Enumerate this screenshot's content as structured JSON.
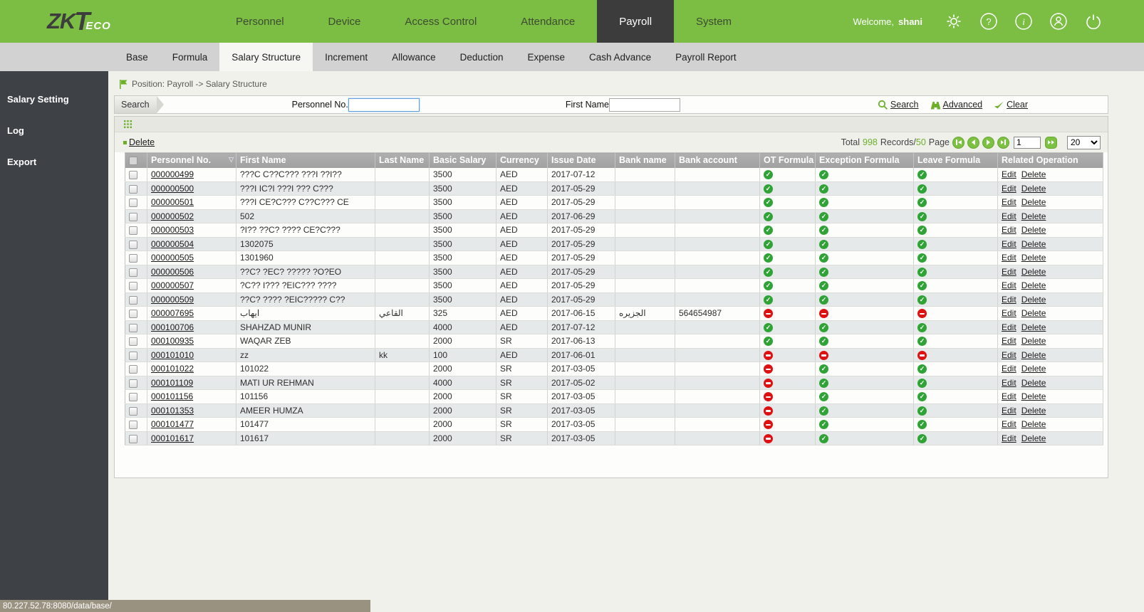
{
  "topnav": {
    "logo": {
      "zk": "ZK",
      "t": "T",
      "eco": "ECO"
    },
    "items": [
      {
        "label": "Personnel",
        "active": false
      },
      {
        "label": "Device",
        "active": false
      },
      {
        "label": "Access Control",
        "active": false
      },
      {
        "label": "Attendance",
        "active": false
      },
      {
        "label": "Payroll",
        "active": true
      },
      {
        "label": "System",
        "active": false
      }
    ],
    "welcome_label": "Welcome,",
    "username": "shani",
    "icons": [
      "settings-icon",
      "help-icon",
      "info-icon",
      "account-icon",
      "power-icon"
    ]
  },
  "tabs": [
    {
      "label": "Base",
      "active": false
    },
    {
      "label": "Formula",
      "active": false
    },
    {
      "label": "Salary Structure",
      "active": true
    },
    {
      "label": "Increment",
      "active": false
    },
    {
      "label": "Allowance",
      "active": false
    },
    {
      "label": "Deduction",
      "active": false
    },
    {
      "label": "Expense",
      "active": false
    },
    {
      "label": "Cash Advance",
      "active": false
    },
    {
      "label": "Payroll Report",
      "active": false
    }
  ],
  "sidebar": {
    "items": [
      "Salary Setting",
      "Log",
      "Export"
    ]
  },
  "breadcrumb": {
    "text": "Position: Payroll -> Salary Structure"
  },
  "search": {
    "panel_label": "Search",
    "fields": [
      {
        "label": "Personnel No.",
        "value": "",
        "focused": true
      },
      {
        "label": "First Name",
        "value": "",
        "focused": false
      }
    ],
    "actions": [
      {
        "label": "Search",
        "icon": "search-icon"
      },
      {
        "label": "Advanced",
        "icon": "advanced-icon"
      },
      {
        "label": "Clear",
        "icon": "clear-icon"
      }
    ]
  },
  "toolbar": {
    "delete_label": "Delete"
  },
  "pagination": {
    "total_label": "Total",
    "total": "998",
    "records_label": "Records/",
    "pages": "50",
    "page_label": "Page",
    "current_page": "1",
    "page_size": "20"
  },
  "table": {
    "columns": [
      "Personnel No.",
      "First Name",
      "Last Name",
      "Basic Salary",
      "Currency",
      "Issue Date",
      "Bank name",
      "Bank account",
      "OT Formula",
      "Exception Formula",
      "Leave Formula",
      "Related Operation"
    ],
    "actions": {
      "edit": "Edit",
      "delete": "Delete"
    },
    "rows": [
      {
        "personnel_no": "000000499",
        "first_name": "???C C??C??? ???I ??I??",
        "last_name": "",
        "basic_salary": "3500",
        "currency": "AED",
        "issue_date": "2017-07-12",
        "bank_name": "",
        "bank_account": "",
        "ot": "ok",
        "exception": "ok",
        "leave": "ok"
      },
      {
        "personnel_no": "000000500",
        "first_name": "???I IC?I ???I ??? C???",
        "last_name": "",
        "basic_salary": "3500",
        "currency": "AED",
        "issue_date": "2017-05-29",
        "bank_name": "",
        "bank_account": "",
        "ot": "ok",
        "exception": "ok",
        "leave": "ok"
      },
      {
        "personnel_no": "000000501",
        "first_name": "???I CE?C??? C??C??? CE",
        "last_name": "",
        "basic_salary": "3500",
        "currency": "AED",
        "issue_date": "2017-05-29",
        "bank_name": "",
        "bank_account": "",
        "ot": "ok",
        "exception": "ok",
        "leave": "ok"
      },
      {
        "personnel_no": "000000502",
        "first_name": "502",
        "last_name": "",
        "basic_salary": "3500",
        "currency": "AED",
        "issue_date": "2017-06-29",
        "bank_name": "",
        "bank_account": "",
        "ot": "ok",
        "exception": "ok",
        "leave": "ok"
      },
      {
        "personnel_no": "000000503",
        "first_name": "?I?? ??C? ???? CE?C???",
        "last_name": "",
        "basic_salary": "3500",
        "currency": "AED",
        "issue_date": "2017-05-29",
        "bank_name": "",
        "bank_account": "",
        "ot": "ok",
        "exception": "ok",
        "leave": "ok"
      },
      {
        "personnel_no": "000000504",
        "first_name": "1302075",
        "last_name": "",
        "basic_salary": "3500",
        "currency": "AED",
        "issue_date": "2017-05-29",
        "bank_name": "",
        "bank_account": "",
        "ot": "ok",
        "exception": "ok",
        "leave": "ok"
      },
      {
        "personnel_no": "000000505",
        "first_name": "1301960",
        "last_name": "",
        "basic_salary": "3500",
        "currency": "AED",
        "issue_date": "2017-05-29",
        "bank_name": "",
        "bank_account": "",
        "ot": "ok",
        "exception": "ok",
        "leave": "ok"
      },
      {
        "personnel_no": "000000506",
        "first_name": "??C? ?EC? ????? ?O?EO",
        "last_name": "",
        "basic_salary": "3500",
        "currency": "AED",
        "issue_date": "2017-05-29",
        "bank_name": "",
        "bank_account": "",
        "ot": "ok",
        "exception": "ok",
        "leave": "ok"
      },
      {
        "personnel_no": "000000507",
        "first_name": "?C?? I??? ?EIC??? ????",
        "last_name": "",
        "basic_salary": "3500",
        "currency": "AED",
        "issue_date": "2017-05-29",
        "bank_name": "",
        "bank_account": "",
        "ot": "ok",
        "exception": "ok",
        "leave": "ok"
      },
      {
        "personnel_no": "000000509",
        "first_name": "??C? ???? ?EIC????? C??",
        "last_name": "",
        "basic_salary": "3500",
        "currency": "AED",
        "issue_date": "2017-05-29",
        "bank_name": "",
        "bank_account": "",
        "ot": "ok",
        "exception": "ok",
        "leave": "ok"
      },
      {
        "personnel_no": "000007695",
        "first_name": "ايهاب",
        "last_name": "القاعي",
        "basic_salary": "325",
        "currency": "AED",
        "issue_date": "2017-06-15",
        "bank_name": "الجزيره",
        "bank_account": "564654987",
        "ot": "no",
        "exception": "no",
        "leave": "no"
      },
      {
        "personnel_no": "000100706",
        "first_name": "SHAHZAD MUNIR",
        "last_name": "",
        "basic_salary": "4000",
        "currency": "AED",
        "issue_date": "2017-07-12",
        "bank_name": "",
        "bank_account": "",
        "ot": "ok",
        "exception": "ok",
        "leave": "ok"
      },
      {
        "personnel_no": "000100935",
        "first_name": "WAQAR ZEB",
        "last_name": "",
        "basic_salary": "2000",
        "currency": "SR",
        "issue_date": "2017-06-13",
        "bank_name": "",
        "bank_account": "",
        "ot": "ok",
        "exception": "ok",
        "leave": "ok"
      },
      {
        "personnel_no": "000101010",
        "first_name": "zz",
        "last_name": "kk",
        "basic_salary": "100",
        "currency": "AED",
        "issue_date": "2017-06-01",
        "bank_name": "",
        "bank_account": "",
        "ot": "no",
        "exception": "no",
        "leave": "no"
      },
      {
        "personnel_no": "000101022",
        "first_name": "101022",
        "last_name": "",
        "basic_salary": "2000",
        "currency": "SR",
        "issue_date": "2017-03-05",
        "bank_name": "",
        "bank_account": "",
        "ot": "no",
        "exception": "ok",
        "leave": "ok"
      },
      {
        "personnel_no": "000101109",
        "first_name": "MATI UR REHMAN",
        "last_name": "",
        "basic_salary": "4000",
        "currency": "SR",
        "issue_date": "2017-05-02",
        "bank_name": "",
        "bank_account": "",
        "ot": "no",
        "exception": "ok",
        "leave": "ok"
      },
      {
        "personnel_no": "000101156",
        "first_name": "101156",
        "last_name": "",
        "basic_salary": "2000",
        "currency": "SR",
        "issue_date": "2017-03-05",
        "bank_name": "",
        "bank_account": "",
        "ot": "no",
        "exception": "ok",
        "leave": "ok"
      },
      {
        "personnel_no": "000101353",
        "first_name": "AMEER HUMZA",
        "last_name": "",
        "basic_salary": "2000",
        "currency": "SR",
        "issue_date": "2017-03-05",
        "bank_name": "",
        "bank_account": "",
        "ot": "no",
        "exception": "ok",
        "leave": "ok"
      },
      {
        "personnel_no": "000101477",
        "first_name": "101477",
        "last_name": "",
        "basic_salary": "2000",
        "currency": "SR",
        "issue_date": "2017-03-05",
        "bank_name": "",
        "bank_account": "",
        "ot": "no",
        "exception": "ok",
        "leave": "ok"
      },
      {
        "personnel_no": "000101617",
        "first_name": "101617",
        "last_name": "",
        "basic_salary": "2000",
        "currency": "SR",
        "issue_date": "2017-03-05",
        "bank_name": "",
        "bank_account": "",
        "ot": "no",
        "exception": "ok",
        "leave": "ok"
      }
    ]
  },
  "statusbar": {
    "url": "80.227.52.78:8080/data/base/"
  },
  "colors": {
    "brand_green": "#7bbe43",
    "accent_green": "#6cb02a",
    "status_ok": "#2fa336",
    "status_blocked": "#dd1111",
    "active_dark": "#3c3c3c"
  }
}
